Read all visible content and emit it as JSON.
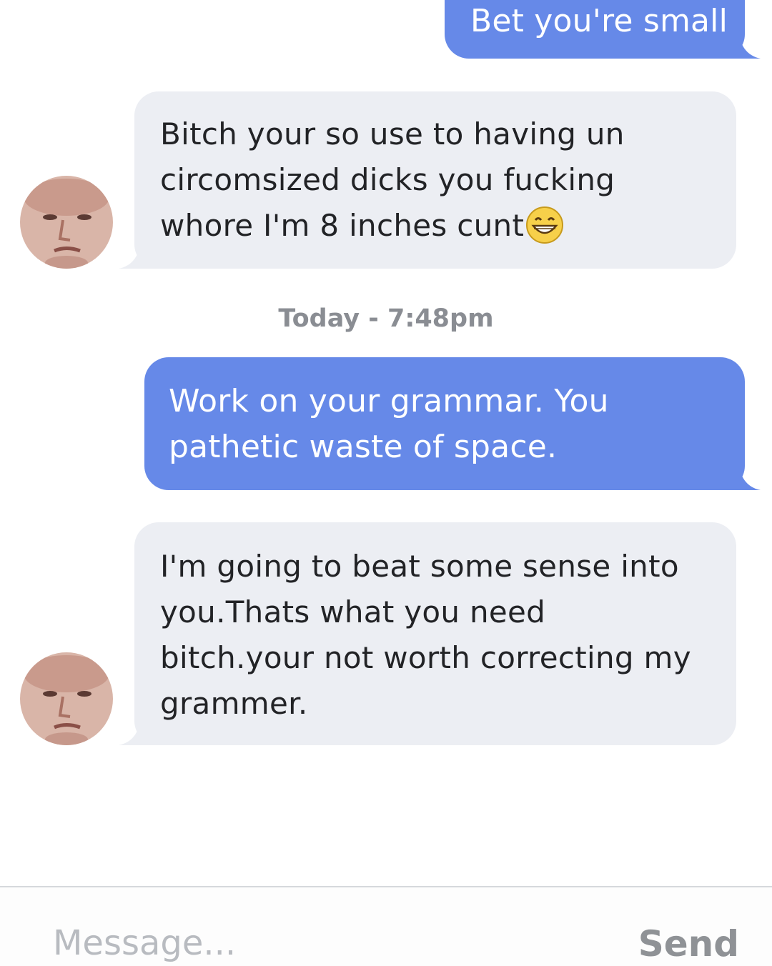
{
  "messages": [
    {
      "direction": "outgoing",
      "text": "Bet you're small"
    },
    {
      "direction": "incoming",
      "text": "Bitch your so use to having un\ncircomsized dicks you fucking\nwhore I'm 8 inches cunt",
      "emoji": "grinning-face-emoji"
    },
    {
      "direction": "outgoing",
      "text": "Work on your grammar. You\npathetic waste of space."
    },
    {
      "direction": "incoming",
      "text": "I'm going to beat some sense into\nyou.Thats what you need\nbitch.your not worth correcting my\ngrammer."
    }
  ],
  "timestamp": "Today - 7:48pm",
  "composer": {
    "placeholder": "Message...",
    "send_label": "Send"
  },
  "colors": {
    "outgoing_bubble": "#6689e8",
    "incoming_bubble": "#eceef3",
    "timestamp": "#8a8d93"
  }
}
